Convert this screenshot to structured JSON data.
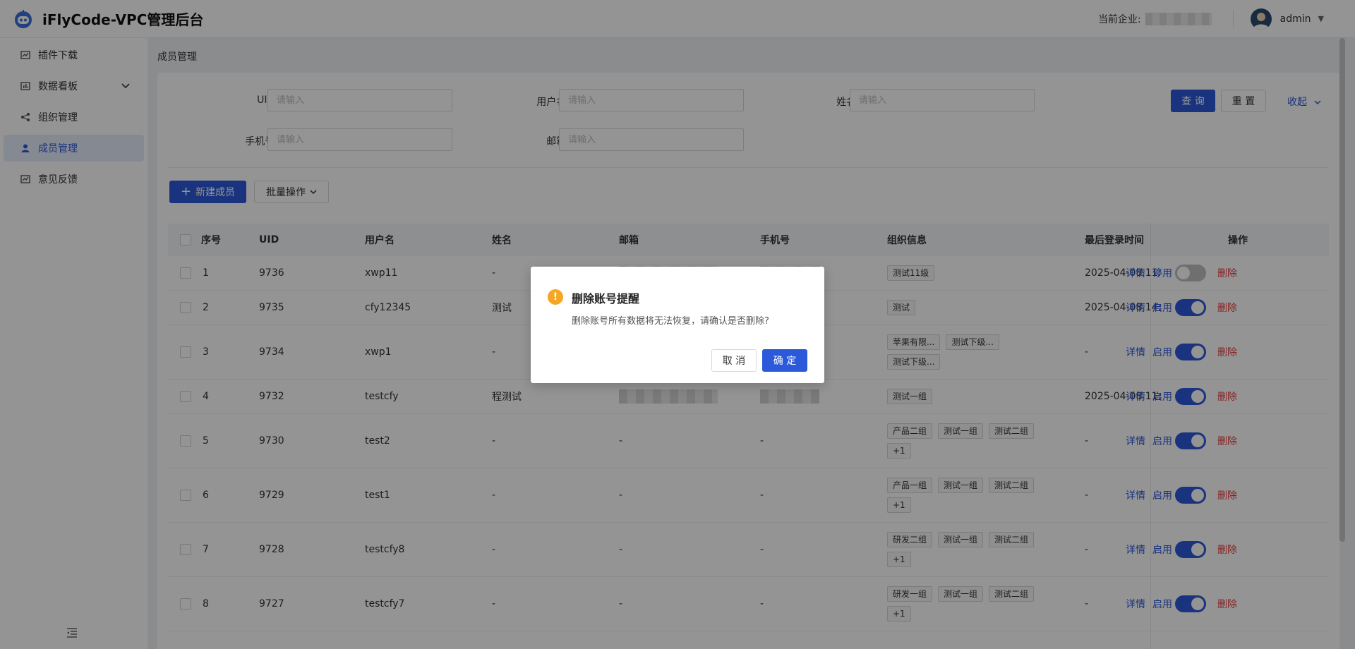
{
  "header": {
    "app_title": "iFlyCode-VPC管理后台",
    "company_label": "当前企业:",
    "user_name": "admin"
  },
  "sidebar": {
    "items": [
      {
        "label": "插件下载",
        "icon": "chart-line-icon"
      },
      {
        "label": "数据看板",
        "icon": "bar-chart-icon"
      },
      {
        "label": "组织管理",
        "icon": "org-tree-icon"
      },
      {
        "label": "成员管理",
        "icon": "user-icon"
      },
      {
        "label": "意见反馈",
        "icon": "feedback-icon"
      }
    ],
    "active_index": 3
  },
  "breadcrumb": "成员管理",
  "filters": {
    "uid_label": "UID:",
    "username_label": "用户名:",
    "name_label": "姓名:",
    "phone_label": "手机号:",
    "email_label": "邮箱:",
    "placeholder": "请输入",
    "search_button": "查 询",
    "reset_button": "重 置",
    "collapse_link": "收起"
  },
  "toolbar": {
    "new_member": "新建成员",
    "batch_ops": "批量操作"
  },
  "table": {
    "columns": [
      "序号",
      "UID",
      "用户名",
      "姓名",
      "邮箱",
      "手机号",
      "组织信息",
      "最后登录时间",
      "操作"
    ],
    "action_detail": "详情",
    "action_delete": "删除",
    "rows": [
      {
        "no": "1",
        "uid": "9736",
        "username": "xwp11",
        "name": "-",
        "email": "",
        "phone": "",
        "orgs": [
          "测试11级"
        ],
        "last_login": "2025-04-08 11:",
        "status_label": "停用",
        "enabled": false
      },
      {
        "no": "2",
        "uid": "9735",
        "username": "cfy12345",
        "name": "测试",
        "email": "",
        "phone": "",
        "orgs": [
          "测试"
        ],
        "last_login": "2025-04-08 14:",
        "status_label": "启用",
        "enabled": true
      },
      {
        "no": "3",
        "uid": "9734",
        "username": "xwp1",
        "name": "-",
        "email": "",
        "phone": "",
        "orgs": [
          "苹果有限...",
          "测试下级...",
          "测试下级..."
        ],
        "last_login": "-",
        "status_label": "启用",
        "enabled": true
      },
      {
        "no": "4",
        "uid": "9732",
        "username": "testcfy",
        "name": "程测试",
        "email": "",
        "phone": "",
        "orgs": [
          "测试一组"
        ],
        "last_login": "2025-04-08 11:",
        "status_label": "启用",
        "enabled": true
      },
      {
        "no": "5",
        "uid": "9730",
        "username": "test2",
        "name": "-",
        "email": "-",
        "phone": "-",
        "orgs": [
          "产品二组",
          "测试一组",
          "测试二组",
          "+1"
        ],
        "last_login": "-",
        "status_label": "启用",
        "enabled": true
      },
      {
        "no": "6",
        "uid": "9729",
        "username": "test1",
        "name": "-",
        "email": "-",
        "phone": "-",
        "orgs": [
          "产品一组",
          "测试一组",
          "测试二组",
          "+1"
        ],
        "last_login": "-",
        "status_label": "启用",
        "enabled": true
      },
      {
        "no": "7",
        "uid": "9728",
        "username": "testcfy8",
        "name": "-",
        "email": "-",
        "phone": "-",
        "orgs": [
          "研发二组",
          "测试一组",
          "测试二组",
          "+1"
        ],
        "last_login": "-",
        "status_label": "启用",
        "enabled": true
      },
      {
        "no": "8",
        "uid": "9727",
        "username": "testcfy7",
        "name": "-",
        "email": "-",
        "phone": "-",
        "orgs": [
          "研发一组",
          "测试一组",
          "测试二组",
          "+1"
        ],
        "last_login": "-",
        "status_label": "启用",
        "enabled": true
      }
    ]
  },
  "dialog": {
    "title": "删除账号提醒",
    "message": "删除账号所有数据将无法恢复，请确认是否删除?",
    "cancel": "取 消",
    "ok": "确 定"
  },
  "colors": {
    "primary": "#2b59d9",
    "danger": "#e83a3a",
    "warning": "#f5a623"
  }
}
